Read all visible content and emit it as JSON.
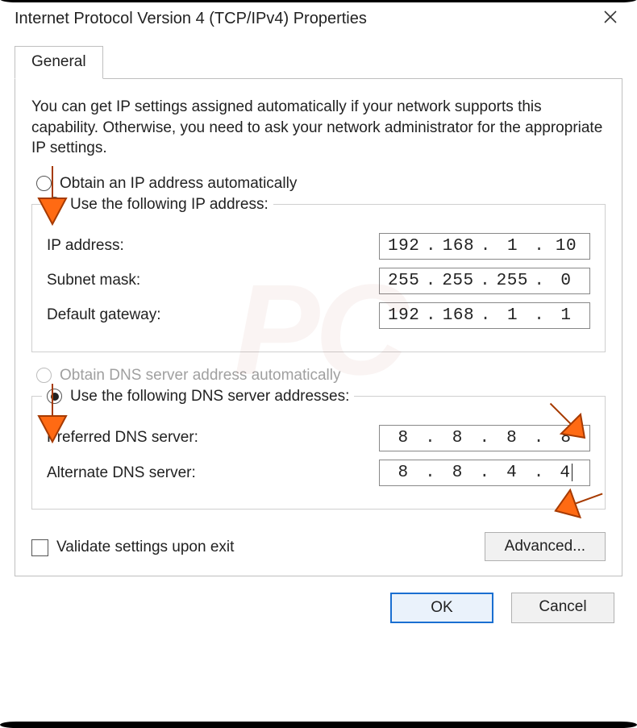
{
  "title": "Internet Protocol Version 4 (TCP/IPv4) Properties",
  "tab": {
    "label": "General"
  },
  "intro": "You can get IP settings assigned automatically if your network supports this capability. Otherwise, you need to ask your network administrator for the appropriate IP settings.",
  "ip_section": {
    "auto_label": "Obtain an IP address automatically",
    "manual_label": "Use the following IP address:",
    "selected": "manual",
    "fields": {
      "ip_label": "IP address:",
      "ip": [
        "192",
        "168",
        "1",
        "10"
      ],
      "mask_label": "Subnet mask:",
      "mask": [
        "255",
        "255",
        "255",
        "0"
      ],
      "gw_label": "Default gateway:",
      "gw": [
        "192",
        "168",
        "1",
        "1"
      ]
    }
  },
  "dns_section": {
    "auto_label": "Obtain DNS server address automatically",
    "auto_enabled": false,
    "manual_label": "Use the following DNS server addresses:",
    "selected": "manual",
    "fields": {
      "pref_label": "Preferred DNS server:",
      "pref": [
        "8",
        "8",
        "8",
        "8"
      ],
      "alt_label": "Alternate DNS server:",
      "alt": [
        "8",
        "8",
        "4",
        "4"
      ]
    }
  },
  "validate_label": "Validate settings upon exit",
  "validate_checked": false,
  "advanced_label": "Advanced...",
  "ok_label": "OK",
  "cancel_label": "Cancel"
}
